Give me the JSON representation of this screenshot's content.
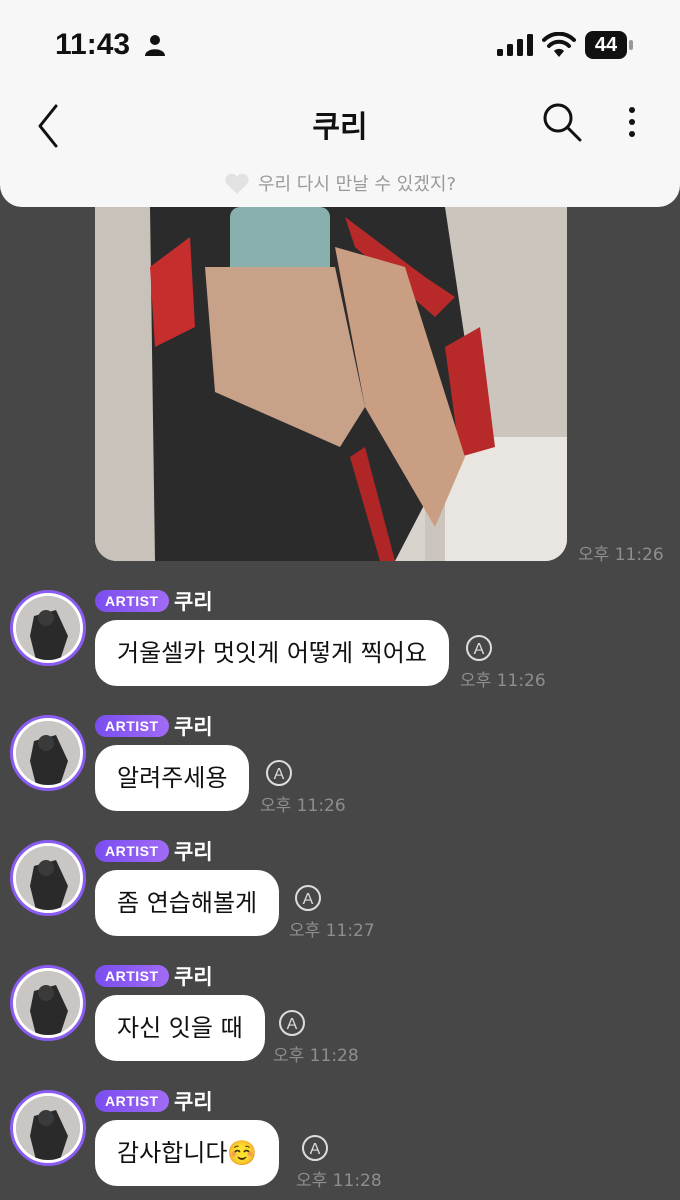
{
  "status": {
    "time": "11:43",
    "battery": "44"
  },
  "header": {
    "title": "쿠리",
    "notice": "우리 다시 만날 수 있겠지?"
  },
  "photo": {
    "time": "오후 11:26"
  },
  "badge": "ARTIST",
  "messages": [
    {
      "name": "쿠리",
      "text": "거울셀카 멋잇게 어떻게 찍어요",
      "time": "오후 11:26"
    },
    {
      "name": "쿠리",
      "text": "알려주세용",
      "time": "오후 11:26"
    },
    {
      "name": "쿠리",
      "text": "좀 연습해볼게",
      "time": "오후 11:27"
    },
    {
      "name": "쿠리",
      "text": "자신 잇을 때",
      "time": "오후 11:28"
    },
    {
      "name": "쿠리",
      "text": "감사합니다☺️",
      "time": "오후 11:28"
    }
  ],
  "colors": {
    "background": "#474747",
    "header": "#f7f7f7",
    "artist_badge": "#8a5cf2"
  }
}
